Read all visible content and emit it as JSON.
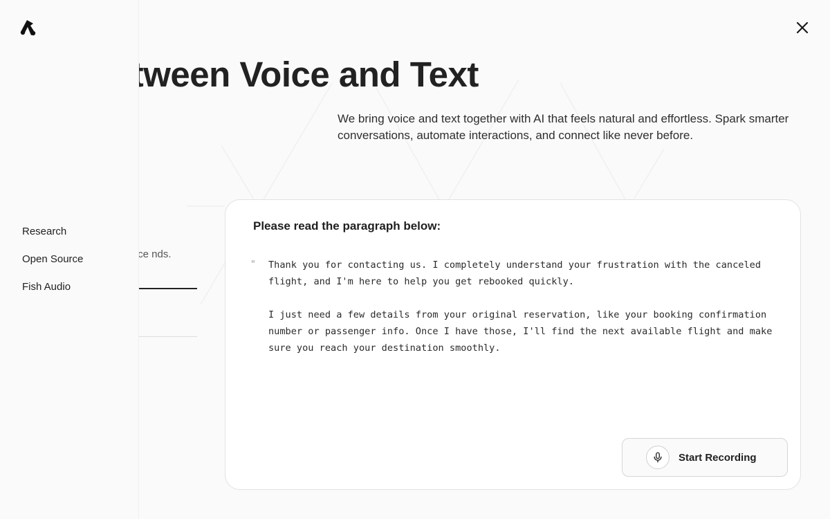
{
  "sidebar": {
    "logo": "fish-audio-logo",
    "items": [
      {
        "label": "Research"
      },
      {
        "label": "Open Source"
      },
      {
        "label": "Fish Audio"
      }
    ]
  },
  "header": {
    "close_icon": "close-icon"
  },
  "hero": {
    "title": "k Between Voice and Text",
    "subtitle": "We bring voice and text together with AI that feels natural and effortless. Spark smarter conversations, automate interactions, and connect like never before."
  },
  "behind_panel": {
    "text": "istic voice nds."
  },
  "card": {
    "title": "Please read the paragraph below:",
    "quote_mark": "\"",
    "paragraphs": [
      "Thank you for contacting us. I completely understand your frustration with the canceled flight, and I'm here to help you get rebooked quickly.",
      "I just need a few details from your original reservation, like your booking confirmation number or passenger info. Once I have those, I'll find the next available flight and make sure you reach your destination smoothly."
    ],
    "record_button": {
      "label": "Start Recording",
      "icon": "microphone-icon"
    }
  },
  "colors": {
    "background": "#fafafa",
    "text": "#1f1f1f",
    "card": "#ffffff",
    "border": "#e2e2e2"
  }
}
